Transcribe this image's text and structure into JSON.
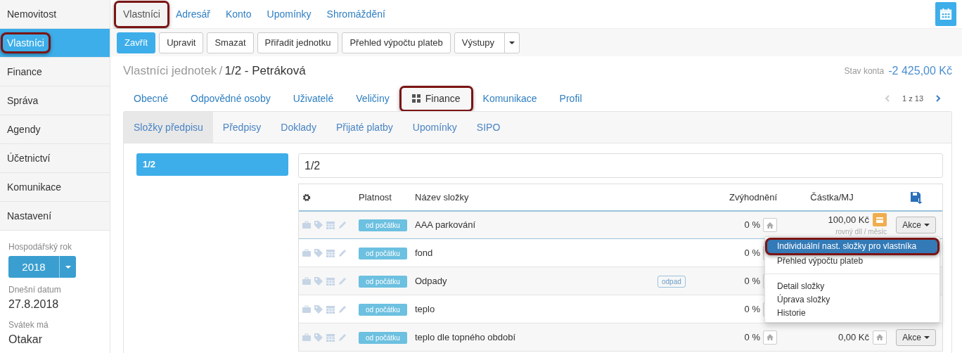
{
  "sidebar": {
    "items": [
      {
        "label": "Nemovitost",
        "selected": false,
        "highlighted": false
      },
      {
        "label": "Vlastníci",
        "selected": true,
        "highlighted": true
      },
      {
        "label": "Finance",
        "selected": false,
        "highlighted": false
      },
      {
        "label": "Správa",
        "selected": false,
        "highlighted": false
      },
      {
        "label": "Agendy",
        "selected": false,
        "highlighted": false
      },
      {
        "label": "Účetnictví",
        "selected": false,
        "highlighted": false
      },
      {
        "label": "Komunikace",
        "selected": false,
        "highlighted": false
      },
      {
        "label": "Nastavení",
        "selected": false,
        "highlighted": false
      }
    ],
    "info": [
      {
        "kind": "select",
        "label": "Hospodářský rok",
        "value": "2018"
      },
      {
        "kind": "text",
        "label": "Dnešní datum",
        "value": "27.8.2018"
      },
      {
        "kind": "text",
        "label": "Svátek má",
        "value": "Otakar"
      }
    ]
  },
  "top_tabs": [
    {
      "label": "Vlastníci",
      "selected": true,
      "highlighted": true
    },
    {
      "label": "Adresář",
      "selected": false,
      "highlighted": false
    },
    {
      "label": "Konto",
      "selected": false,
      "highlighted": false
    },
    {
      "label": "Upomínky",
      "selected": false,
      "highlighted": false
    },
    {
      "label": "Shromáždění",
      "selected": false,
      "highlighted": false
    }
  ],
  "toolbar": [
    {
      "label": "Zavřít",
      "kind": "primary"
    },
    {
      "label": "Upravit",
      "kind": "default"
    },
    {
      "label": "Smazat",
      "kind": "default"
    },
    {
      "label": "Přiřadit jednotku",
      "kind": "default"
    },
    {
      "label": "Přehled výpočtu plateb",
      "kind": "default"
    },
    {
      "label": "Výstupy",
      "kind": "split"
    }
  ],
  "breadcrumb": {
    "parent": "Vlastníci jednotek",
    "separator": "/",
    "current": "1/2 - Petráková"
  },
  "account": {
    "label": "Stav konta",
    "value": "-2 425,00 Kč"
  },
  "detail_tabs": [
    {
      "label": "Obecné",
      "selected": false,
      "highlighted": false
    },
    {
      "label": "Odpovědné osoby",
      "selected": false,
      "highlighted": false
    },
    {
      "label": "Uživatelé",
      "selected": false,
      "highlighted": false
    },
    {
      "label": "Veličiny",
      "selected": false,
      "highlighted": false
    },
    {
      "label": "Finance",
      "selected": true,
      "highlighted": true
    },
    {
      "label": "Komunikace",
      "selected": false,
      "highlighted": false
    },
    {
      "label": "Profil",
      "selected": false,
      "highlighted": false
    }
  ],
  "pager": {
    "text": "1 z 13",
    "prev_disabled": true,
    "next_disabled": false
  },
  "sub_tabs": [
    {
      "label": "Složky předpisu",
      "selected": true
    },
    {
      "label": "Předpisy",
      "selected": false
    },
    {
      "label": "Doklady",
      "selected": false
    },
    {
      "label": "Přijaté platby",
      "selected": false
    },
    {
      "label": "Upomínky",
      "selected": false
    },
    {
      "label": "SIPO",
      "selected": false
    }
  ],
  "units": [
    {
      "label": "1/2",
      "selected": true
    }
  ],
  "unit_heading": "1/2",
  "table": {
    "columns": [
      "Platnost",
      "Název složky",
      "Zvýhodnění",
      "Částka/MJ"
    ],
    "rows": [
      {
        "validity": "od počátku",
        "name": "AAA parkování",
        "discount": "0 %",
        "amount": "100,00 Kč",
        "amount_button": {
          "kind": "card"
        },
        "note": "rovný díl / měsíc",
        "action": "Akce",
        "selected": true
      },
      {
        "validity": "od počátku",
        "name": "fond",
        "discount": "0 %",
        "selected": false
      },
      {
        "validity": "od počátku",
        "name": "Odpady",
        "tag": "odpad",
        "discount": "0 %",
        "selected": false
      },
      {
        "validity": "od počátku",
        "name": "teplo",
        "discount": "0 %",
        "selected": false
      },
      {
        "validity": "od počátku",
        "name": "teplo dle topného období",
        "discount": "0 %",
        "amount": "0,00 Kč",
        "amount_button": {
          "kind": "home"
        },
        "action": "Akce",
        "selected": false
      }
    ]
  },
  "dropdown": {
    "items": [
      {
        "kind": "item",
        "label": "Individuální nast. složky pro vlastníka",
        "selected": true,
        "highlighted": true
      },
      {
        "kind": "item",
        "label": "Přehled výpočtu plateb",
        "selected": false,
        "highlighted": false
      },
      {
        "kind": "divider"
      },
      {
        "kind": "item",
        "label": "Detail složky",
        "selected": false,
        "highlighted": false
      },
      {
        "kind": "item",
        "label": "Úprava složky",
        "selected": false,
        "highlighted": false
      },
      {
        "kind": "item",
        "label": "Historie",
        "selected": false,
        "highlighted": false
      }
    ]
  }
}
